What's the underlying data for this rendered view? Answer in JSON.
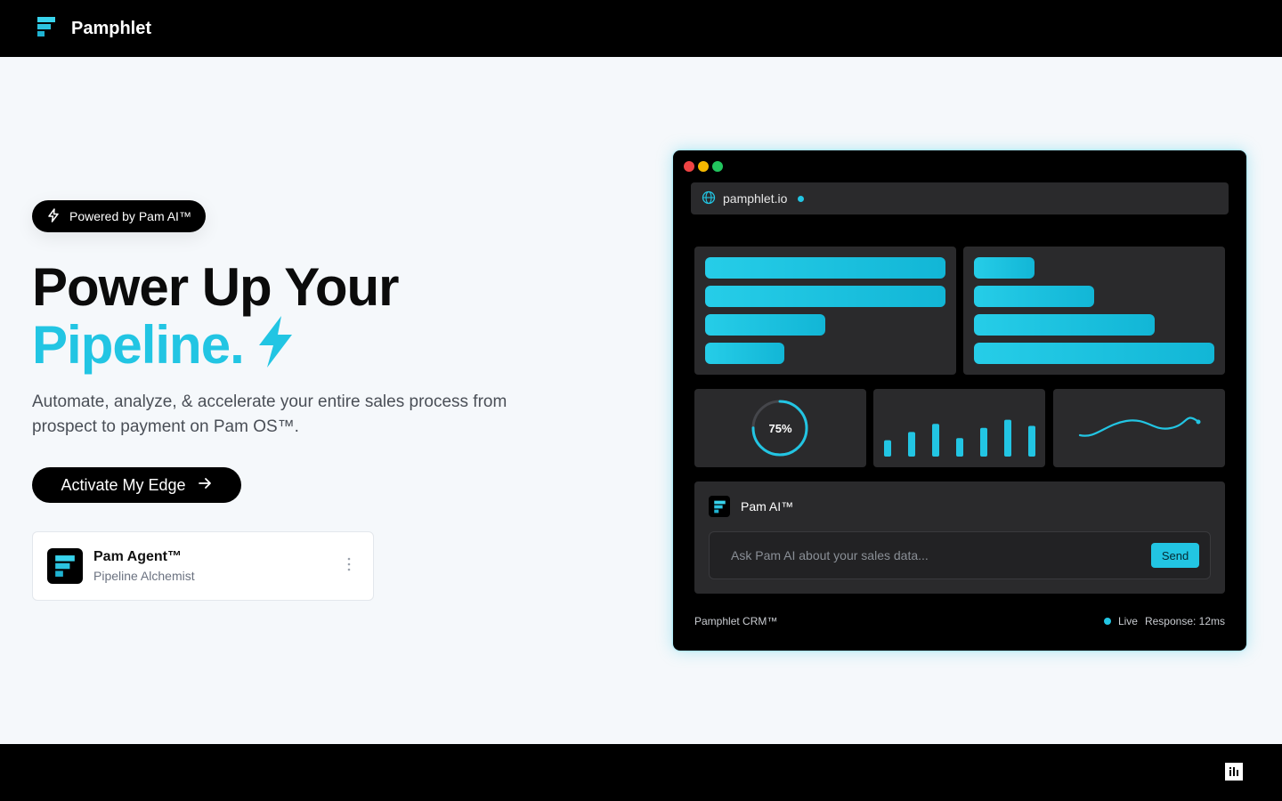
{
  "nav": {
    "brand": "Pamphlet"
  },
  "hero": {
    "badge": "Powered by Pam AI™",
    "title_line1": "Power Up Your",
    "title_line2": "Pipeline.",
    "subtitle": "Automate, analyze, & accelerate your entire sales process from prospect to payment on Pam OS™.",
    "cta_label": "Activate My Edge"
  },
  "agent_card": {
    "name": "Pam Agent™",
    "role": "Pipeline Alchemist"
  },
  "preview": {
    "url": "pamphlet.io",
    "card_a_bar_fill": [
      1.0,
      1.0,
      0.5,
      0.33
    ],
    "card_b_bar_fill": [
      0.25,
      0.5,
      0.75,
      1.0
    ],
    "gauge": {
      "label": "75%",
      "value": 0.75
    },
    "mini_bars": [
      0.4,
      0.6,
      0.8,
      0.45,
      0.7,
      0.9,
      0.75
    ],
    "chat": {
      "title": "Pam AI™",
      "placeholder": "Ask Pam AI about your sales data...",
      "send_label": "Send"
    },
    "footer_left": "Pamphlet CRM™",
    "status_live": "Live",
    "status_response": "Response: 12ms"
  },
  "colors": {
    "accent": "#22c5e3",
    "dot_red": "#ef4444",
    "dot_yellow": "#f5b800",
    "dot_green": "#22c55e"
  },
  "icons": {
    "brand": "pamphlet-logo-icon",
    "badge": "lightning-icon",
    "cta": "arrow-right-icon",
    "url": "globe-icon",
    "footer": "intercom-icon"
  }
}
